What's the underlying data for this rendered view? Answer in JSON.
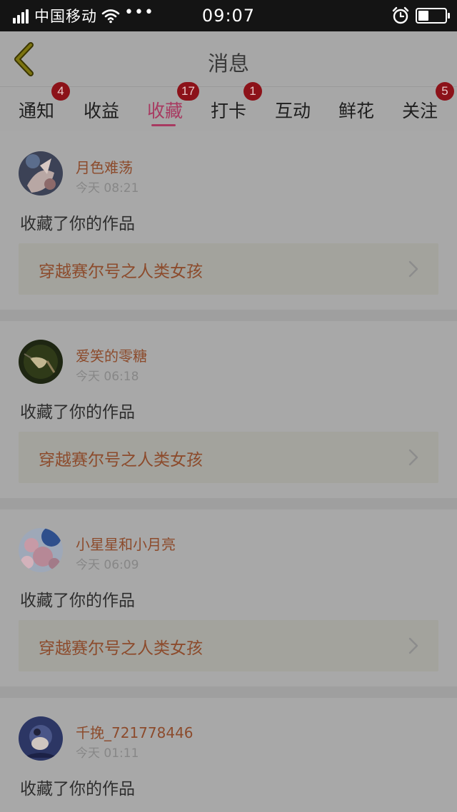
{
  "status_bar": {
    "carrier": "中国移动",
    "more": "•••",
    "time": "09:07",
    "battery_level": 0.4
  },
  "header": {
    "title": "消息"
  },
  "tabs": [
    {
      "label": "通知",
      "badge": "4"
    },
    {
      "label": "收益",
      "badge": ""
    },
    {
      "label": "收藏",
      "badge": "17",
      "active": true
    },
    {
      "label": "打卡",
      "badge": "1"
    },
    {
      "label": "互动",
      "badge": ""
    },
    {
      "label": "鲜花",
      "badge": ""
    },
    {
      "label": "关注",
      "badge": "5"
    }
  ],
  "feed": [
    {
      "user": "月色难荡",
      "time": "今天 08:21",
      "action": "收藏了你的作品",
      "work": "穿越赛尔号之人类女孩"
    },
    {
      "user": "爱笑的零糖",
      "time": "今天 06:18",
      "action": "收藏了你的作品",
      "work": "穿越赛尔号之人类女孩"
    },
    {
      "user": "小星星和小月亮",
      "time": "今天 06:09",
      "action": "收藏了你的作品",
      "work": "穿越赛尔号之人类女孩"
    },
    {
      "user": "千挽_721778446",
      "time": "今天 01:11",
      "action": "收藏了你的作品",
      "work": ""
    }
  ]
}
